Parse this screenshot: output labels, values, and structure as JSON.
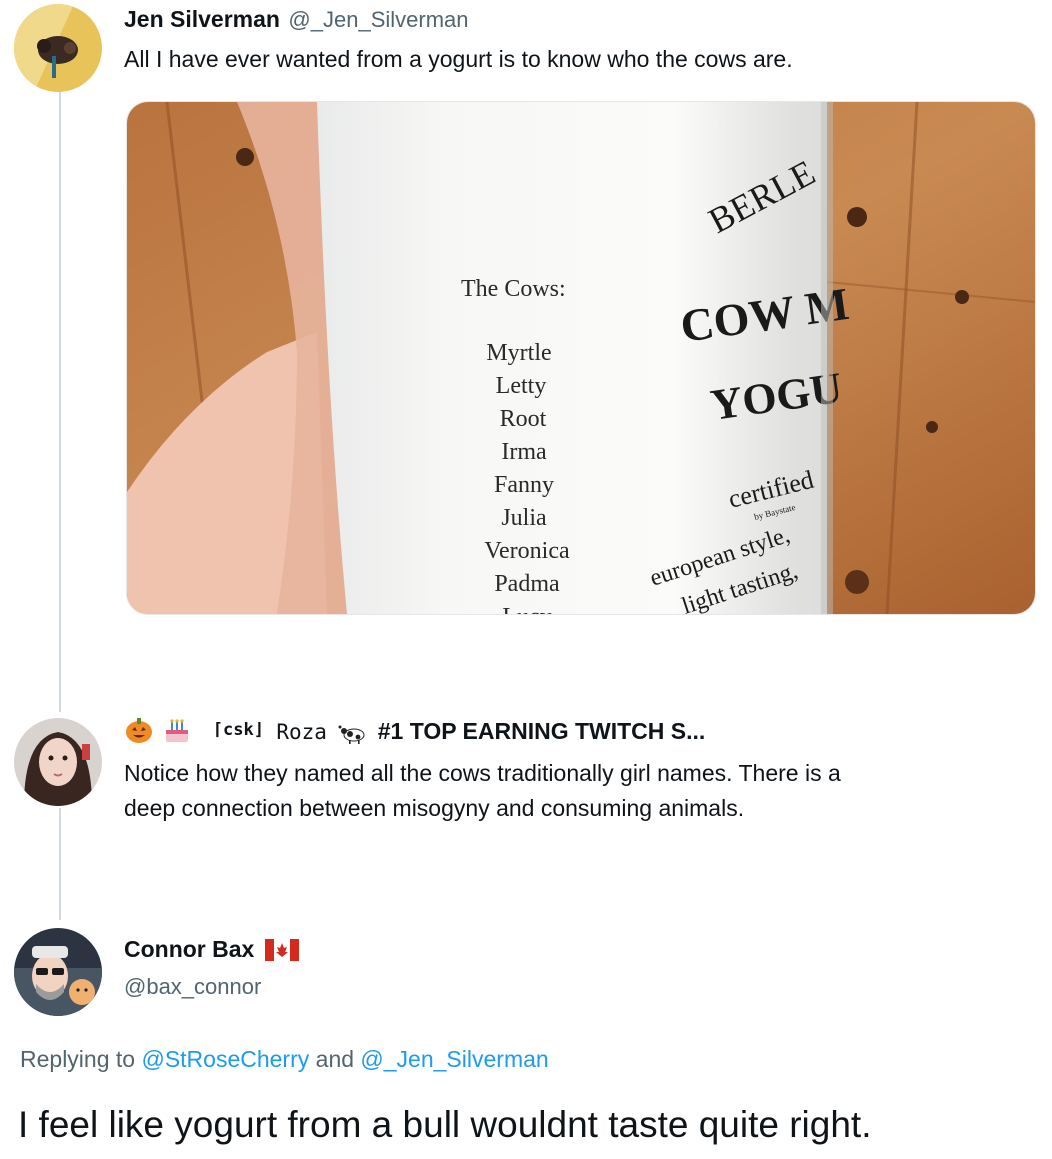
{
  "tweet1": {
    "name": "Jen Silverman",
    "handle": "@_Jen_Silverman",
    "text": "All I have ever wanted from a yogurt is to know who the cows are.",
    "photo": {
      "cows_heading": "The Cows:",
      "cows": [
        "Myrtle",
        "Letty",
        "Root",
        "Irma",
        "Fanny",
        "Julia",
        "Veronica",
        "Padma",
        "Lucy"
      ],
      "brand": "BERLE",
      "label_line1": "COW M",
      "label_line2": "YOGU",
      "certified": "certified",
      "by_line": "by Baystate",
      "style1": "european style,",
      "style2": "light tasting,"
    }
  },
  "tweet2": {
    "name_prefix": "⌈csk⌋",
    "name_roza": "Roza",
    "name_rest": "#1 TOP EARNING TWITCH S...",
    "text_line1": "Notice how they named all the cows traditionally girl names. There is a",
    "text_line2": "deep connection between misogyny and consuming animals."
  },
  "tweet3": {
    "name": "Connor Bax",
    "flag": "canada-flag",
    "handle": "@bax_connor",
    "replying_prefix": "Replying to",
    "mention1": "@StRoseCherry",
    "and_word": "and",
    "mention2": "@_Jen_Silverman",
    "text": "I feel like yogurt from a bull wouldnt taste quite right."
  },
  "colors": {
    "text": "#0f1419",
    "muted": "#536471",
    "link": "#1d9bf0",
    "thread_line": "#cfd9de"
  }
}
